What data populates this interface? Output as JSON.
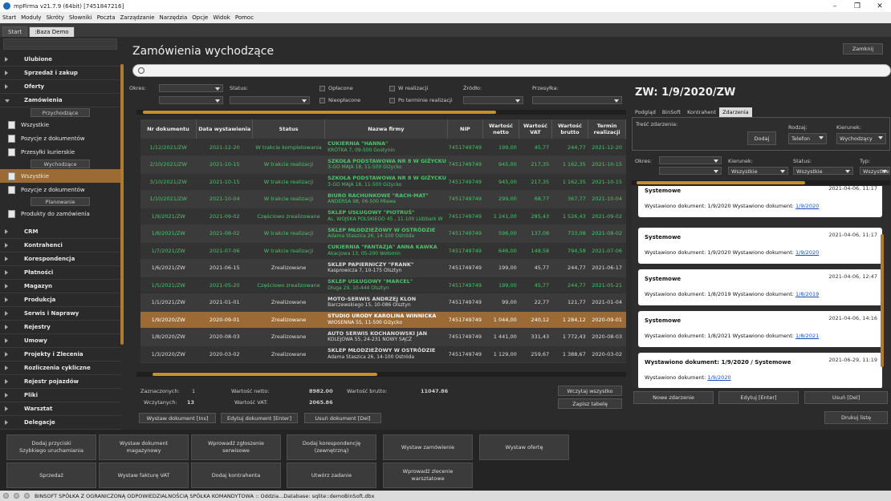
{
  "window": {
    "title": "mpFirma v21.7.9 (64bit) [7451847216]"
  },
  "menu": [
    "Start",
    "Moduły",
    "Skróty",
    "Słowniki",
    "Poczta",
    "Zarządzanie",
    "Narzędzia",
    "Opcje",
    "Widok",
    "Pomoc"
  ],
  "tabs": [
    "Start",
    ":Baza Demo"
  ],
  "sidebar": {
    "groups_top": [
      "Ulubione",
      "Sprzedaż i zakup",
      "Oferty"
    ],
    "open_group": "Zamówienia",
    "sub1": "Przychodzące",
    "links1": [
      "Wszystkie",
      "Pozycje z dokumentów",
      "Przesyłki kurierskie"
    ],
    "sub2": "Wychodzące",
    "links2": [
      "Wszystkie",
      "Pozycje z dokumentów"
    ],
    "sub3": "Planowanie",
    "links3": [
      "Produkty do zamówienia"
    ],
    "groups_bottom": [
      "CRM",
      "Kontrahenci",
      "Korespondencja",
      "Płatności",
      "Magazyn",
      "Produkcja",
      "Serwis i Naprawy",
      "Rejestry",
      "Umowy",
      "Projekty i Zlecenia",
      "Rozliczenia cykliczne",
      "Rejestr pojazdów",
      "Pliki",
      "Warsztat",
      "Delegacje",
      "Pracownicy"
    ]
  },
  "main": {
    "title": "Zamówienia wychodzące",
    "close_label": "Zamknij",
    "filters": {
      "okres": "Okres:",
      "status": "Status:",
      "oplacone": "Opłacone",
      "nieoplacone": "Nieopłacone",
      "w_realizacji": "W realizacji",
      "po_terminie": "Po terminie realizacji",
      "zrodlo": "Źródło:",
      "przesylka": "Przesyłka:"
    },
    "columns": [
      "Nr dokumentu",
      "Data wystawienia",
      "Status",
      "Nazwa firmy",
      "NIP",
      "Wartość netto",
      "Wartość VAT",
      "Wartość brutto",
      "Termin realizacji"
    ],
    "rows": [
      {
        "nr": "1/12/2021/ZW",
        "data": "2021-12-20",
        "status": "W trakcie kompletowania",
        "firma": "CUKIERNIA \"HANNA\"",
        "adres": "KRÓTKA 7, 09-500 Gostynin",
        "nip": "7451749749",
        "netto": "199,00",
        "vat": "45,77",
        "brutto": "244,77",
        "termin": "2021-12-20",
        "green": true
      },
      {
        "nr": "2/10/2021/ZW",
        "data": "2021-10-15",
        "status": "W trakcie realizacji",
        "firma": "SZKOŁA PODSTAWOWA NR 8 W GIŻYCKU",
        "adres": "3-GO MAJA 18, 11-500 Giżycko",
        "nip": "7451749749",
        "netto": "945,00",
        "vat": "217,35",
        "brutto": "1 162,35",
        "termin": "2021-10-15",
        "green": true
      },
      {
        "nr": "3/10/2021/ZW",
        "data": "2021-10-15",
        "status": "W trakcie realizacji",
        "firma": "SZKOŁA PODSTAWOWA NR 8 W GIŻYCKU",
        "adres": "3-GO MAJA 18, 11-500 Giżycko",
        "nip": "7451749749",
        "netto": "945,00",
        "vat": "217,35",
        "brutto": "1 162,35",
        "termin": "2021-10-15",
        "green": true
      },
      {
        "nr": "1/10/2021/ZW",
        "data": "2021-10-04",
        "status": "W trakcie realizacji",
        "firma": "BIURO RACHUNKOWE \"RACH-MAT\"",
        "adres": "ANDERSA 98, 06-500 Mława",
        "nip": "7451749749",
        "netto": "299,00",
        "vat": "68,77",
        "brutto": "367,77",
        "termin": "2021-10-04",
        "green": true
      },
      {
        "nr": "1/9/2021/ZW",
        "data": "2021-09-02",
        "status": "Częściowo zrealizowane",
        "firma": "SKLEP USŁUGOWY \"PIOTRUŚ\"",
        "adres": "AL. WOJSKA POLSKIEGO 45 , 11-100 Lidzbark W",
        "nip": "7451749749",
        "netto": "1 241,00",
        "vat": "285,43",
        "brutto": "1 526,43",
        "termin": "2021-09-02",
        "green": true
      },
      {
        "nr": "1/8/2021/ZW",
        "data": "2021-08-02",
        "status": "W trakcie realizacji",
        "firma": "SKLEP MŁODZIEŻOWY W OSTRÓDZIE",
        "adres": "Adama Staszica 26, 14-100 Ostróda",
        "nip": "7451749749",
        "netto": "596,00",
        "vat": "137,08",
        "brutto": "733,08",
        "termin": "2021-08-02",
        "green": true
      },
      {
        "nr": "1/7/2021/ZW",
        "data": "2021-07-06",
        "status": "W trakcie realizacji",
        "firma": "CUKIERNIA \"FANTAZJA\" ANNA KAWKA",
        "adres": "Akacjowa 13, 05-200 Wołomin",
        "nip": "7451749749",
        "netto": "646,00",
        "vat": "148,58",
        "brutto": "794,58",
        "termin": "2021-07-06",
        "green": true
      },
      {
        "nr": "1/6/2021/ZW",
        "data": "2021-06-15",
        "status": "Zrealizowane",
        "firma": "SKLEP PAPIERNICZY \"FRANK\"",
        "adres": "Kasprowicza 7, 10-175 Olsztyn",
        "nip": "7451749749",
        "netto": "199,00",
        "vat": "45,77",
        "brutto": "244,77",
        "termin": "2021-06-17",
        "green": false
      },
      {
        "nr": "1/5/2021/ZW",
        "data": "2021-05-20",
        "status": "Częściowo zrealizowane",
        "firma": "SKLEP USŁUGOWY \"MARCEL\"",
        "adres": "Długa 29, 10-444 Olsztyn",
        "nip": "7451749749",
        "netto": "199,00",
        "vat": "45,77",
        "brutto": "244,77",
        "termin": "2021-05-21",
        "green": true
      },
      {
        "nr": "1/1/2021/ZW",
        "data": "2021-01-01",
        "status": "Zrealizowane",
        "firma": "MOTO-SERWIS ANDRZEJ KLON",
        "adres": "Barczewskiego 15, 10-086 Olsztyn",
        "nip": "7451749749",
        "netto": "99,00",
        "vat": "22,77",
        "brutto": "121,77",
        "termin": "2021-01-04",
        "green": false
      },
      {
        "nr": "1/9/2020/ZW",
        "data": "2020-09-01",
        "status": "Zrealizowane",
        "firma": "STUDIO URODY KAROLINA WINNICKA",
        "adres": "WIOSENNA 55, 11-500 Giżycko",
        "nip": "7451749749",
        "netto": "1 044,00",
        "vat": "240,12",
        "brutto": "1 284,12",
        "termin": "2020-09-01",
        "green": false,
        "selected": true
      },
      {
        "nr": "1/8/2020/ZW",
        "data": "2020-08-03",
        "status": "Zrealizowane",
        "firma": "AUTO SERWIS KOCHANOWSKI JAN",
        "adres": "KOLEJOWA 55, 24-231 NOWY SĄCZ",
        "nip": "7451749749",
        "netto": "1 441,00",
        "vat": "331,43",
        "brutto": "1 772,43",
        "termin": "2020-08-03",
        "green": false
      },
      {
        "nr": "1/3/2020/ZW",
        "data": "2020-03-02",
        "status": "Zrealizowane",
        "firma": "SKLEP MŁODZIEŻOWY W OSTRÓDZIE",
        "adres": "Adama Staszica 26, 14-100 Ostróda",
        "nip": "7451749749",
        "netto": "1 129,00",
        "vat": "259,67",
        "brutto": "1 388,67",
        "termin": "2020-03-02",
        "green": false
      }
    ],
    "sums": {
      "zaznaczonych_label": "Zaznaczonych:",
      "zaznaczonych": "1",
      "wczytanych_label": "Wczytanych:",
      "wczytanych": "13",
      "netto_label": "Wartość netto:",
      "netto": "8982.00",
      "vat_label": "Wartość VAT:",
      "vat": "2065.86",
      "brutto_label": "Wartość brutto:",
      "brutto": "11047.86"
    },
    "buttons": {
      "wczytaj": "Wczytaj wszystko",
      "zapisz": "Zapisz tabelę",
      "wystaw": "Wystaw dokument [Ins]",
      "edytuj": "Edytuj dokument [Enter]",
      "usun": "Usuń dokument [Del]"
    }
  },
  "right": {
    "title": "ZW: 1/9/2020/ZW",
    "tabs": [
      "Podgląd",
      "BinSoft",
      "Kontrahent",
      "Zdarzenia"
    ],
    "tresc": "Treść zdarzenia:",
    "dodaj": "Dodaj",
    "rodzaj": "Rodzaj:",
    "rodzaj_val": "Telefon",
    "kierunek": "Kierunek:",
    "kierunek_val": "Wychodzący",
    "okres": "Okres:",
    "kier2": "Kierunek:",
    "kier2_val": "Wszystkie",
    "status": "Status:",
    "status_val": "Wszystkie",
    "typ": "Typ:",
    "typ_val": "Wszystkie",
    "cards": [
      {
        "title": "Systemowe",
        "date": "2021-04-06, 11:17",
        "body": "Wystawiono dokument: 1/9/2020 Wystawiono dokument: ",
        "link": "1/9/2020"
      },
      {
        "title": "Systemowe",
        "date": "2021-04-06, 11:17",
        "body": "Wystawiono dokument: 1/9/2020 Wystawiono dokument: ",
        "link": "1/9/2020"
      },
      {
        "title": "Systemowe",
        "date": "2021-04-06, 12:47",
        "body": "Wystawiono dokument: 1/8/2019 Wystawiono dokument: ",
        "link": "1/8/2019"
      },
      {
        "title": "Systemowe",
        "date": "2021-04-06, 14:16",
        "body": "Wystawiono dokument: 1/8/2021 Wystawiono dokument: ",
        "link": "1/8/2021"
      },
      {
        "title": "Wystawiono dokument: 1/9/2020 / Systemowe",
        "date": "2021-06-29, 11:19",
        "body": "Wystawiono dokument: ",
        "link": "1/9/2020"
      }
    ],
    "buttons": {
      "nowe": "Nowe zdarzenie",
      "edytuj": "Edytuj [Enter]",
      "usun": "Usuń [Del]",
      "drukuj": "Drukuj listę"
    }
  },
  "bottom": {
    "row1": [
      "Dodaj przyciski\nSzybkiego uruchamiania",
      "Wystaw dokument\nmagazynowy",
      "Wprowadź zgłoszenie\nserwisowe",
      "Dodaj korespondencję\n(zewnętrzną)",
      "Wystaw zamówienie",
      "Wystaw ofertę"
    ],
    "row2": [
      "Sprzedaż",
      "Wystaw fakturę VAT",
      "Dodaj kontrahenta",
      "Utwórz zadanie",
      "Wprowadź zlecenie\nwarsztatowe"
    ]
  },
  "status": "BINSOFT SPÓŁKA Z OGRANICZONĄ ODPOWIEDZIALNOŚCIĄ SPÓŁKA KOMANDYTOWA :: Oddzia...Database: sqlite::demoBinSoft.dbx"
}
